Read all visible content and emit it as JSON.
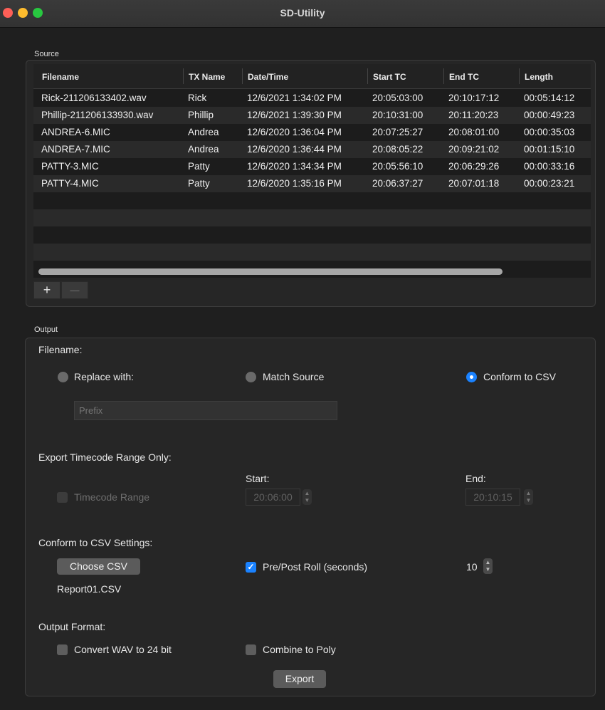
{
  "window": {
    "title": "SD-Utility"
  },
  "source": {
    "label": "Source",
    "columns": [
      "Filename",
      "TX Name",
      "Date/Time",
      "Start TC",
      "End TC",
      "Length"
    ],
    "rows": [
      [
        "Rick-211206133402.wav",
        "Rick",
        "12/6/2021 1:34:02 PM",
        "20:05:03:00",
        "20:10:17:12",
        "00:05:14:12"
      ],
      [
        "Phillip-211206133930.wav",
        "Phillip",
        "12/6/2021 1:39:30 PM",
        "20:10:31:00",
        "20:11:20:23",
        "00:00:49:23"
      ],
      [
        "ANDREA-6.MIC",
        "Andrea",
        "12/6/2020 1:36:04 PM",
        "20:07:25:27",
        "20:08:01:00",
        "00:00:35:03"
      ],
      [
        "ANDREA-7.MIC",
        "Andrea",
        "12/6/2020 1:36:44 PM",
        "20:08:05:22",
        "20:09:21:02",
        "00:01:15:10"
      ],
      [
        "PATTY-3.MIC",
        "Patty",
        "12/6/2020 1:34:34 PM",
        "20:05:56:10",
        "20:06:29:26",
        "00:00:33:16"
      ],
      [
        "PATTY-4.MIC",
        "Patty",
        "12/6/2020 1:35:16 PM",
        "20:06:37:27",
        "20:07:01:18",
        "00:00:23:21"
      ]
    ],
    "add_label": "+",
    "remove_label": "—"
  },
  "output": {
    "label": "Output",
    "filename_label": "Filename:",
    "replace_with": "Replace with:",
    "match_source": "Match Source",
    "conform_csv": "Conform to CSV",
    "prefix_placeholder": "Prefix",
    "export_tc_label": "Export Timecode Range Only:",
    "timecode_range": "Timecode Range",
    "start_label": "Start:",
    "end_label": "End:",
    "start_value": "20:06:00",
    "end_value": "20:10:15",
    "csv_settings_label": "Conform to CSV Settings:",
    "choose_csv": "Choose CSV",
    "csv_file": "Report01.CSV",
    "pre_post_roll": "Pre/Post Roll (seconds)",
    "pre_post_value": "10",
    "output_format_label": "Output Format:",
    "convert_wav": "Convert WAV to 24 bit",
    "combine_poly": "Combine to Poly",
    "export": "Export"
  },
  "colors": {
    "accent": "#1a82ff"
  }
}
